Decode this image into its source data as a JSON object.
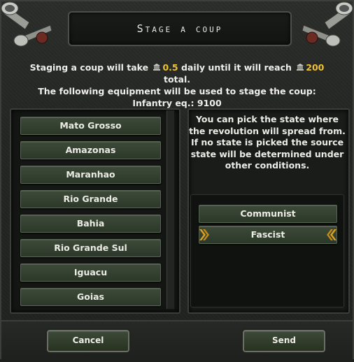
{
  "window": {
    "title": "Stage a coup"
  },
  "intro": {
    "line1_prefix": "Staging a coup will take",
    "daily_value": "0.5",
    "line1_middle": "daily until it will reach",
    "total_value": "200",
    "line1_suffix": "total.",
    "line2": "The following equipment will be used to stage the coup:",
    "line3": "Infantry eq.: 9100"
  },
  "states": [
    "Mato Grosso",
    "Amazonas",
    "Maranhao",
    "Rio Grande",
    "Bahia",
    "Rio Grande Sul",
    "Iguacu",
    "Goias"
  ],
  "info": "You can pick the state where the revolution will spread from. If no state is picked the source state will be determined under other conditions.",
  "ideologies": {
    "first": "Communist",
    "second": "Fascist"
  },
  "buttons": {
    "cancel": "Cancel",
    "send": "Send"
  },
  "colors": {
    "gold": "#f0c232",
    "button_green": "#344231",
    "chevron": "#e0a020"
  },
  "icons": {
    "resource": "political-power-icon",
    "horn": "gramophone-horn-icon"
  }
}
